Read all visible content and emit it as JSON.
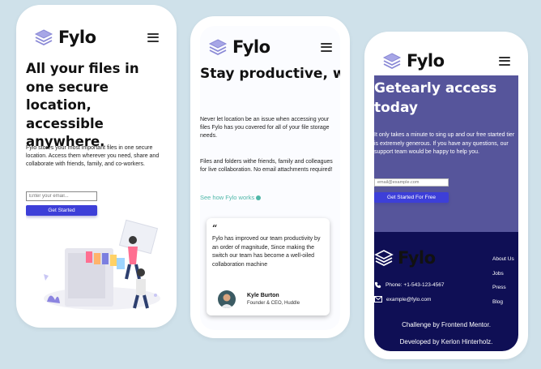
{
  "brand": {
    "name": "Fylo"
  },
  "colors": {
    "background": "#cfe1ea",
    "accent": "#3d3fd8",
    "hero_purple": "#56559b",
    "footer_navy": "#0f0f55",
    "link_teal": "#4fb7a8"
  },
  "phone1": {
    "title": "All your files in one secure location, accessible anywhere.",
    "description": "Fylo stores your most important files in one secure location. Access them wherever you need, share and collaborate with friends, family, and co-workers.",
    "email_placeholder": "Enter your email...",
    "cta_label": "Get Started"
  },
  "phone2": {
    "title": "Stay productive, wherever you are",
    "paragraph1": "Never let location be an issue when accessing your files Fylo has you covered for all of your file storage needs.",
    "paragraph2": "Files and folders withe friends, family and colleagues for live collaboration. No email attachments required!",
    "link_label": "See how Fylo works",
    "testimonial": {
      "quote_mark": "“",
      "text": "Fylo has improved our team productivity by an order of magnitude, Since making the switch our team has become a well-oiled collaboration machine",
      "name": "Kyle Burton",
      "role": "Founder & CEO, Huddle"
    }
  },
  "phone3": {
    "title": "Getearly access today",
    "description": "It only takes a minute to sing up and our free started tier is extremely generous. If you have any questions, our support team would be happy to help you.",
    "email_placeholder": "email@example.com",
    "cta_label": "Get Started For Free",
    "footer": {
      "phone": "Phone: +1-543-123-4567",
      "email": "example@fylo.com",
      "links": [
        "About Us",
        "Jobs",
        "Press",
        "Blog"
      ],
      "credit1": "Challenge by Frontend Mentor.",
      "credit2": "Developed by Kerlon Hinterholz."
    }
  }
}
